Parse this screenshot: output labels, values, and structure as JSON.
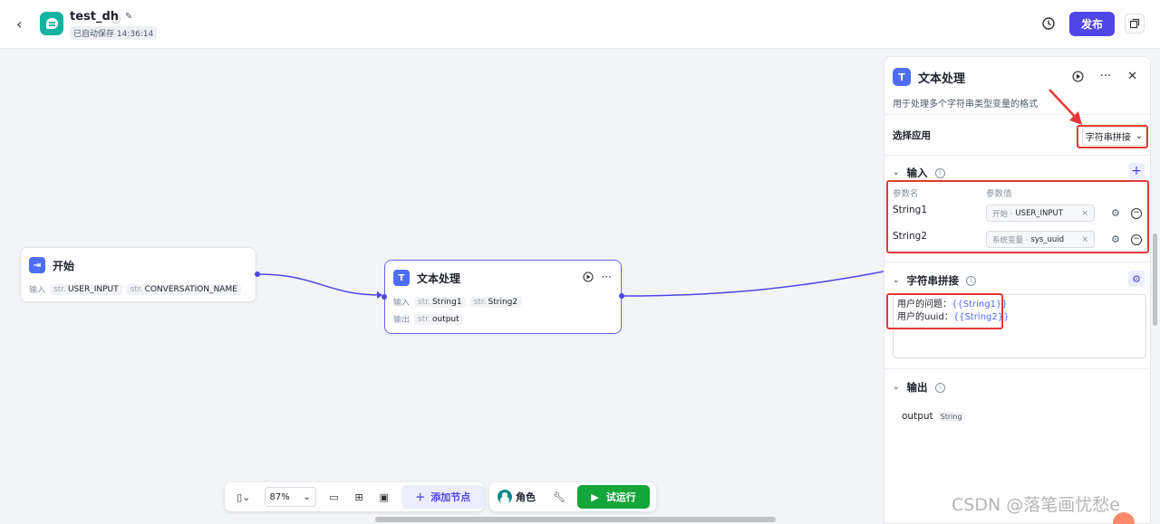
{
  "header": {
    "back_glyph": "‹",
    "app_name": "test_dh",
    "autosave_text": "已自动保存 14:36:14",
    "publish_label": "发布"
  },
  "nodes": {
    "start": {
      "title": "开始",
      "input_label": "输入",
      "vars": [
        {
          "type": "str.",
          "name": "USER_INPUT"
        },
        {
          "type": "str.",
          "name": "CONVERSATION_NAME"
        }
      ]
    },
    "text_process": {
      "title": "文本处理",
      "input_label": "输入",
      "output_label": "输出",
      "inputs": [
        {
          "type": "str.",
          "name": "String1"
        },
        {
          "type": "str.",
          "name": "String2"
        }
      ],
      "outputs": [
        {
          "type": "str.",
          "name": "output"
        }
      ]
    }
  },
  "toolbar": {
    "zoom_value": "87%",
    "add_node_label": "添加节点",
    "role_label": "角色",
    "run_label": "试运行"
  },
  "panel": {
    "title": "文本处理",
    "description": "用于处理多个字符串类型变量的格式",
    "select_app_label": "选择应用",
    "select_app_value": "字符串拼接",
    "input_section": "输入",
    "col_name": "参数名",
    "col_value": "参数值",
    "params": [
      {
        "name": "String1",
        "source": "开始 · ",
        "value": "USER_INPUT"
      },
      {
        "name": "String2",
        "source": "系统变量 · ",
        "value": "sys_uuid"
      }
    ],
    "concat_section": "字符串拼接",
    "template_lines": [
      {
        "text": "用户的问题：",
        "var": "{{String1}}"
      },
      {
        "text": "用户的uuid：",
        "var": "{{String2}}"
      }
    ],
    "output_section": "输出",
    "output_name": "output",
    "output_type": "String"
  },
  "watermark": "CSDN @落笔画忧愁e",
  "colors": {
    "accent": "#4f46e5",
    "run_green": "#14a63a",
    "highlight_red": "#e53935",
    "app_logo": "#13b3a1"
  }
}
